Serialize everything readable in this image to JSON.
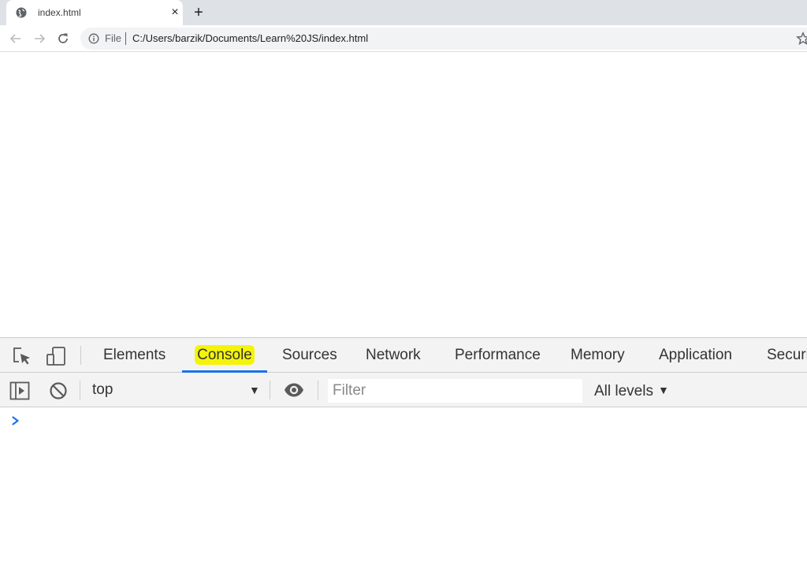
{
  "browser": {
    "tab": {
      "title": "index.html",
      "favicon": "globe-icon",
      "close_glyph": "×"
    },
    "new_tab_glyph": "+",
    "address_bar": {
      "scheme_label": "File",
      "url": "C:/Users/barzik/Documents/Learn%20JS/index.html"
    },
    "icons": [
      "back-arrow-icon",
      "forward-arrow-icon",
      "reload-icon",
      "info-icon",
      "star-icon"
    ]
  },
  "devtools": {
    "tabs": [
      {
        "label": "Elements",
        "active": false
      },
      {
        "label": "Console",
        "active": true
      },
      {
        "label": "Sources",
        "active": false
      },
      {
        "label": "Network",
        "active": false
      },
      {
        "label": "Performance",
        "active": false
      },
      {
        "label": "Memory",
        "active": false
      },
      {
        "label": "Application",
        "active": false
      },
      {
        "label": "Securi",
        "active": false
      }
    ],
    "console_toolbar": {
      "context": "top",
      "filter_placeholder": "Filter",
      "levels_label": "All levels"
    },
    "colors": {
      "highlight": "#f4f40a",
      "active_tab_underline": "#1a73e8",
      "prompt": "#1a73e8"
    }
  }
}
